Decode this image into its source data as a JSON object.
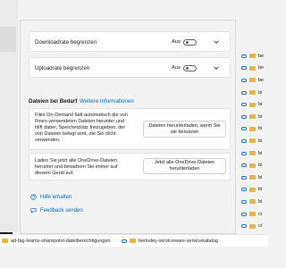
{
  "bandwidth": {
    "download": {
      "label": "Downloadrate begrenzen",
      "state": "Aus"
    },
    "upload": {
      "label": "Uploadrate begrenzen",
      "state": "Aus"
    }
  },
  "files_on_demand": {
    "title": "Dateien bei Bedarf",
    "more_info_link": "Weitere Informationen",
    "free_space": {
      "text": "Files On-Demand lädt automatisch die von Ihnen verwendeten Dateien herunter und hilft dabei, Speicherplatz freizugeben, der von Dateien belegt wird, die Sie nicht verwenden.",
      "button": "Dateien herunterladen, wenn Sie sie benutzen"
    },
    "download_all": {
      "text": "Laden Sie jetzt alle OneDrive-Dateien herunter und bewahren Sie immer auf diesem Gerät auf.",
      "button": "Jetzt alle OneDrive-Dateien herunterladen"
    }
  },
  "links": {
    "help": "Hilfe erhalten",
    "feedback": "Feedback senden"
  },
  "background": {
    "list_items": [
      "be",
      "be",
      "be",
      "bi",
      "bi",
      "bi",
      "bi",
      "bi",
      "bi",
      "bi",
      "bi",
      "bi",
      "bi",
      "ci",
      "ci",
      "d",
      "d"
    ],
    "bottom_left": "ad-fag-teams-sharepoint-dateiberechtigungen",
    "bottom_right": "berkeley-serviceware-servicekatalog"
  },
  "colors": {
    "accent": "#0067c0",
    "folder": "#e6b54a",
    "cloud": "#1c70c8"
  }
}
